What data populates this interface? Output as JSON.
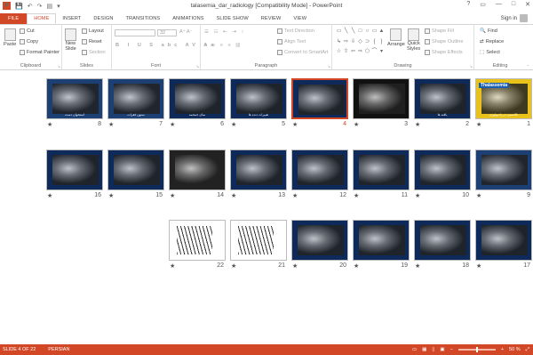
{
  "window": {
    "title": "talasemia_dar_radiology [Compatibility Mode] - PowerPoint",
    "controls": [
      "?",
      "▭",
      "—",
      "□",
      "✕"
    ]
  },
  "qat": {
    "logo": "P",
    "save": "💾",
    "undo": "↶",
    "redo": "↷",
    "start": "▤",
    "more": "▾"
  },
  "tabs": [
    "FILE",
    "HOME",
    "INSERT",
    "DESIGN",
    "TRANSITIONS",
    "ANIMATIONS",
    "SLIDE SHOW",
    "REVIEW",
    "VIEW"
  ],
  "active_tab": "HOME",
  "signin": "Sign in",
  "ribbon": {
    "clipboard": {
      "label": "Clipboard",
      "paste": "Paste",
      "cut": "Cut",
      "copy": "Copy",
      "format_painter": "Format Painter"
    },
    "slides": {
      "label": "Slides",
      "new_slide": "New",
      "new_slide2": "Slide",
      "layout": "Layout",
      "reset": "Reset",
      "section": "Section"
    },
    "font": {
      "label": "Font",
      "size": "32"
    },
    "paragraph": {
      "label": "Paragraph",
      "text_direction": "Text Direction",
      "align_text": "Align Text",
      "convert_smartart": "Convert to SmartArt"
    },
    "drawing": {
      "label": "Drawing",
      "arrange": "Arrange",
      "quick_styles": "Quick",
      "quick_styles2": "Styles",
      "shape_fill": "Shape Fill",
      "shape_outline": "Shape Outline",
      "shape_effects": "Shape Effects"
    },
    "editing": {
      "label": "Editing",
      "find": "Find",
      "replace": "Replace",
      "select": "Select"
    }
  },
  "slides": [
    {
      "n": "1",
      "bg": "#e8c21a",
      "title": "Thalassemia",
      "cap": "تالاسمی در رادیولوژی"
    },
    {
      "n": "2",
      "bg": "#0e2a5a",
      "title": "",
      "cap": "یافته ها"
    },
    {
      "n": "3",
      "bg": "#111111",
      "title": "",
      "cap": ""
    },
    {
      "n": "4",
      "bg": "#0e2a5a",
      "title": "",
      "cap": "",
      "selected": true
    },
    {
      "n": "5",
      "bg": "#0e2a5a",
      "title": "",
      "cap": "تغییرات دنده ها"
    },
    {
      "n": "6",
      "bg": "#0e2a5a",
      "title": "",
      "cap": "نمای جمجمه"
    },
    {
      "n": "7",
      "bg": "#1c3f74",
      "title": "",
      "cap": "ستون فقرات"
    },
    {
      "n": "8",
      "bg": "#1c3f74",
      "title": "",
      "cap": "استخوان دست"
    },
    {
      "n": "9",
      "bg": "#1c3f74",
      "title": "",
      "cap": ""
    },
    {
      "n": "10",
      "bg": "#0e2a5a",
      "title": "",
      "cap": ""
    },
    {
      "n": "11",
      "bg": "#0e2a5a",
      "title": "",
      "cap": ""
    },
    {
      "n": "12",
      "bg": "#0e2a5a",
      "title": "",
      "cap": ""
    },
    {
      "n": "13",
      "bg": "#0e2a5a",
      "title": "",
      "cap": ""
    },
    {
      "n": "14",
      "bg": "#222222",
      "title": "",
      "cap": ""
    },
    {
      "n": "15",
      "bg": "#0e2a5a",
      "title": "",
      "cap": ""
    },
    {
      "n": "16",
      "bg": "#0e2a5a",
      "title": "",
      "cap": ""
    },
    {
      "n": "17",
      "bg": "#0e2a5a",
      "title": "",
      "cap": ""
    },
    {
      "n": "18",
      "bg": "#0e2a5a",
      "title": "",
      "cap": ""
    },
    {
      "n": "19",
      "bg": "#0e2a5a",
      "title": "",
      "cap": ""
    },
    {
      "n": "20",
      "bg": "#0e2a5a",
      "title": "",
      "cap": ""
    },
    {
      "n": "21",
      "bg": "#ffffff",
      "title": "",
      "cap": ""
    },
    {
      "n": "22",
      "bg": "#ffffff",
      "title": "",
      "cap": ""
    }
  ],
  "status": {
    "slide": "SLIDE 4 OF 22",
    "lang": "PERSIAN",
    "zoom": "50 %"
  },
  "colors": {
    "accent": "#d24726",
    "slide_blue": "#0e2a5a"
  }
}
